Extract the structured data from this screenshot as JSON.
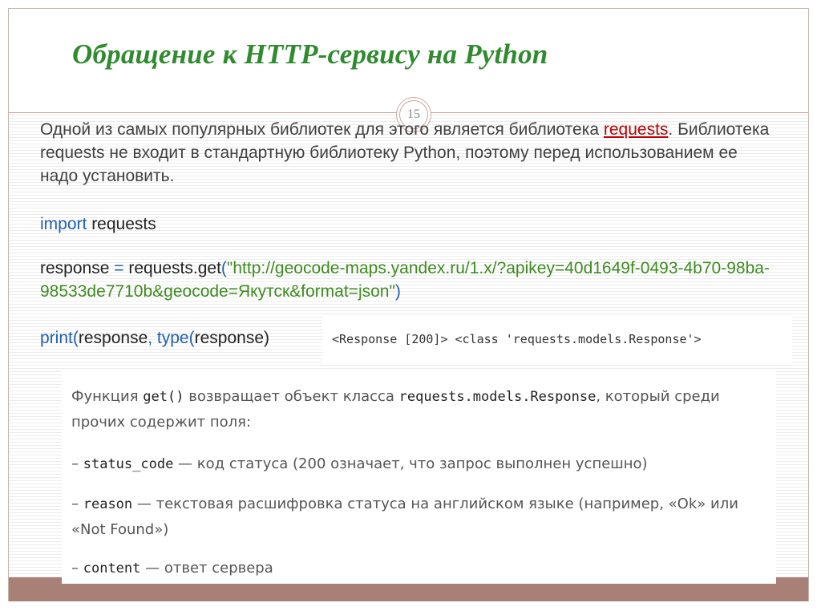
{
  "title": "Обращение к HTTP-сервису на Python",
  "page_number": "15",
  "intro": {
    "part1": "Одной из самых популярных библиотек для этого является библиотека ",
    "link": "requests",
    "part2": ". Библиотека requests не входит в стандартную библиотеку Python, поэтому перед использованием ее надо установить."
  },
  "code": {
    "line1_kw": "import",
    "line1_rest": " requests",
    "line2_a": "response ",
    "line2_eq": "=",
    "line2_b": " requests.",
    "line2_fn": "get",
    "line2_paren": "(",
    "line2_str": "\"http://geocode-maps.yandex.ru/1.x/?apikey=40d1649f-0493-4b70-98ba-98533de7710b&geocode=Якутск&format=json\"",
    "line2_close": ")",
    "line3_fn": "print",
    "line3_a": "(",
    "line3_b": "response",
    "line3_c": ", ",
    "line3_type": "type",
    "line3_d": "(",
    "line3_e": "response",
    "line3_f": ")"
  },
  "output": "<Response [200]> <class 'requests.models.Response'>",
  "doc": {
    "p1_a": "Функция ",
    "p1_code1": "get()",
    "p1_b": " возвращает объект класса ",
    "p1_code2": "requests.models.Response",
    "p1_c": ", который среди прочих содержит поля:",
    "item1_dash": "– ",
    "item1_code": "status_code",
    "item1_text": " — код статуса (200 означает, что запрос выполнен успешно)",
    "item2_dash": "– ",
    "item2_code": "reason",
    "item2_text": " — текстовая расшифровка статуса на английском языке (например, «Ok» или «Not Found»)",
    "item3_dash": "– ",
    "item3_code": "content",
    "item3_text": " — ответ сервера"
  }
}
